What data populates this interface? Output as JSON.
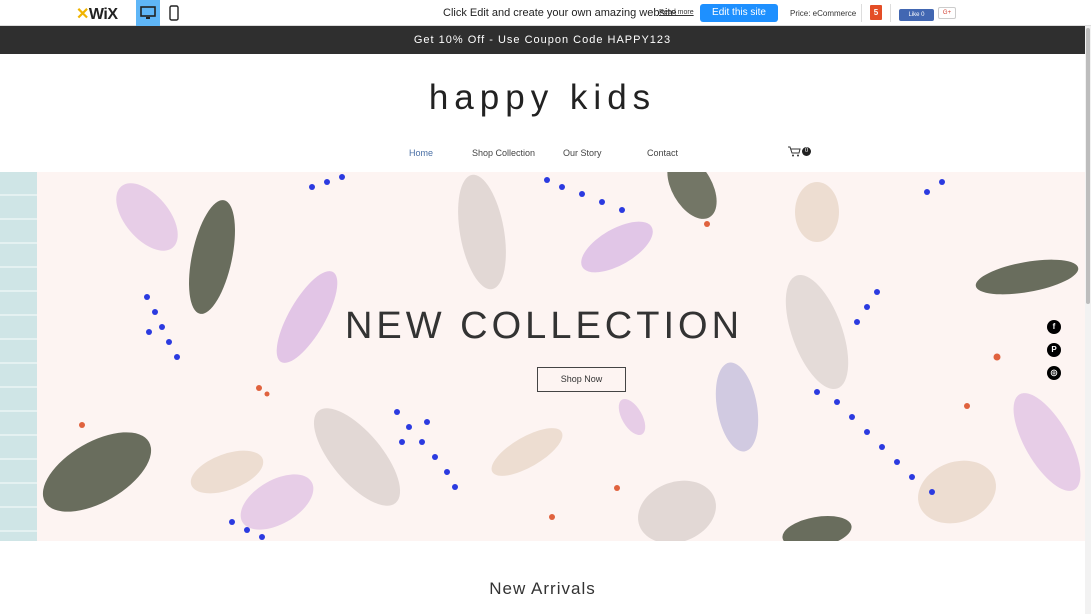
{
  "wixbar": {
    "logo": "WiX",
    "message": "Click Edit and create your own amazing website",
    "read_more": "Read more",
    "edit_button": "Edit this site",
    "price": "Price: eCommerce",
    "html5": "5",
    "like": "Like 0",
    "gplus": "G+"
  },
  "promo": "Get 10% Off - Use Coupon Code HAPPY123",
  "site_title": "happy kids",
  "nav": [
    {
      "label": "Home",
      "active": true
    },
    {
      "label": "Shop Collection"
    },
    {
      "label": "Our Story"
    },
    {
      "label": "Contact"
    }
  ],
  "cart_count": "0",
  "hero": {
    "title": "NEW COLLECTION",
    "button": "Shop Now"
  },
  "social": [
    {
      "icon": "facebook-icon",
      "glyph": "f"
    },
    {
      "icon": "pinterest-icon",
      "glyph": "P"
    },
    {
      "icon": "instagram-icon",
      "glyph": "◎"
    }
  ],
  "section_title": "New Arrivals",
  "colors": {
    "accent": "#1e90ff",
    "nav_active": "#4a6fa5",
    "promo_bg": "#2f2f2f",
    "hero_bg": "#fdf4f2"
  }
}
